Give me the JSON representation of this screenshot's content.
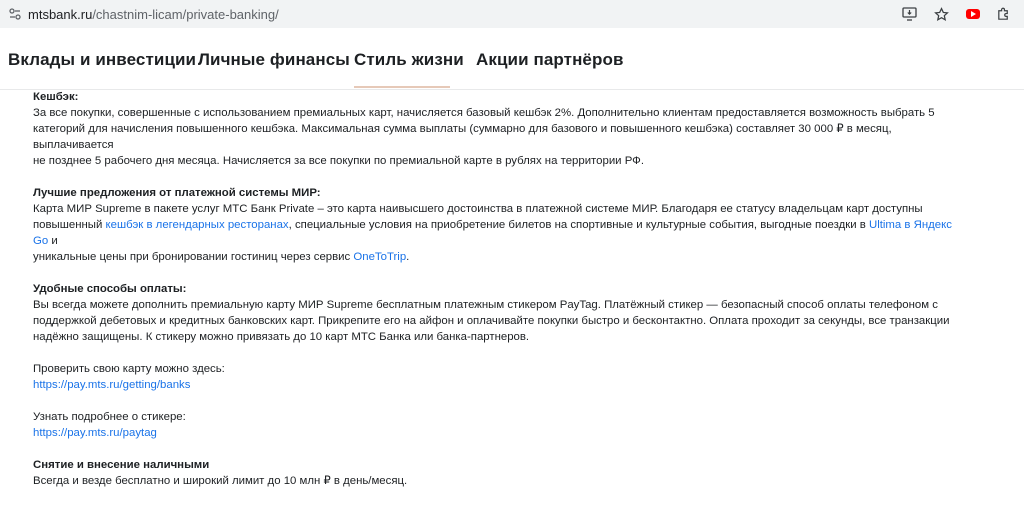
{
  "browser": {
    "url_host": "mtsbank.ru",
    "url_path": "/chastnim-licam/private-banking/",
    "icons": [
      "site-info-icon",
      "install-app-icon",
      "bookmark-star-icon",
      "youtube-extension-icon",
      "extensions-puzzle-icon"
    ]
  },
  "nav": {
    "items": [
      {
        "label": "Вклады и инвестиции"
      },
      {
        "label": "Личные финансы"
      },
      {
        "label": "Стиль жизни"
      },
      {
        "label": "Акции партнёров"
      }
    ],
    "active_index": 2,
    "underline_color": "#e6c9b8"
  },
  "content": {
    "cashback": {
      "heading": "Кешбэк:",
      "line1": "За все покупки, совершенные с использованием премиальных карт, начисляется базовый кешбэк 2%. Дополнительно клиентам предоставляется возможность выбрать 5",
      "line2": "категорий для начисления повышенного кешбэка. Максимальная сумма выплаты (суммарно для базового и повышенного кешбэка) составляет 30 000 ₽ в месяц, выплачивается",
      "line3": "не позднее 5 рабочего дня месяца. Начисляется за все покупки по премиальной карте в рублях на территории РФ."
    },
    "mir": {
      "heading": "Лучшие предложения от платежной системы МИР:",
      "line1": "Карта МИР Supreme в пакете услуг МТС Банк Private – это карта наивысшего достоинства в платежной системе МИР. Благодаря ее статусу владельцам карт доступны",
      "line2_pre": "повышенный ",
      "line2_link1": "кешбэк в легендарных ресторанах",
      "line2_mid": ", специальные условия на приобретение билетов на спортивные и культурные события, выгодные поездки в ",
      "line2_link2": "Ultima в Яндекс Go",
      "line2_post": " и",
      "line3_pre": "уникальные цены при бронировании гостиниц через сервис ",
      "line3_link": "OneToTrip",
      "line3_post": "."
    },
    "payment": {
      "heading": "Удобные способы оплаты:",
      "line1": "Вы всегда можете дополнить премиальную карту МИР Supreme бесплатным платежным стикером PayTag. Платёжный стикер — безопасный способ оплаты телефоном с",
      "line2": "поддержкой дебетовых и кредитных банковских карт. Прикрепите его на айфон и оплачивайте покупки быстро и бесконтактно. Оплата проходит за секунды, все транзакции",
      "line3": "надёжно защищены. К стикеру можно привязать до 10 карт МТС Банка или банка-партнеров."
    },
    "check_card": {
      "label": "Проверить свою карту можно здесь:",
      "link": "https://pay.mts.ru/getting/banks"
    },
    "sticker": {
      "label": "Узнать подробнее о стикере:",
      "link": "https://pay.mts.ru/paytag"
    },
    "cash": {
      "heading": "Снятие и внесение наличными",
      "line1": "Всегда и везде бесплатно и широкий лимит до 10 млн ₽ в день/месяц."
    }
  },
  "colors": {
    "link": "#1a73e8",
    "text": "#1d2023"
  }
}
